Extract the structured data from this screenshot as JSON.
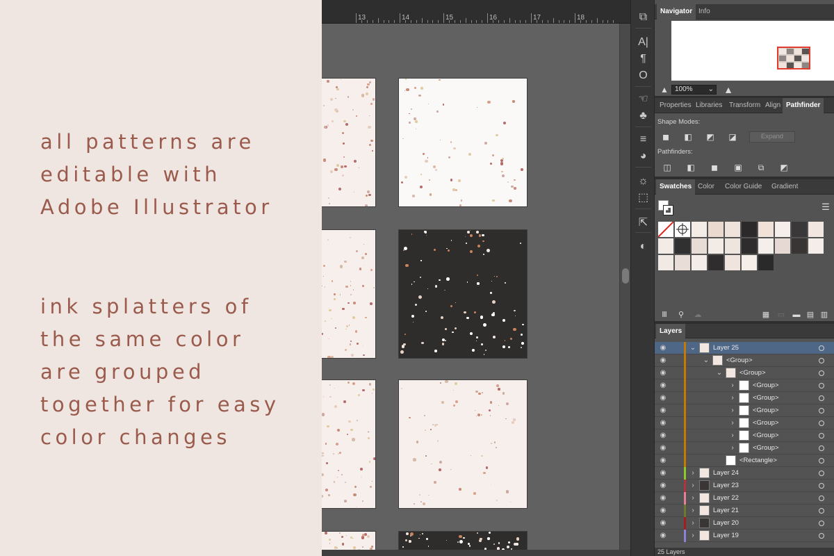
{
  "promo": {
    "block_a": [
      "all patterns are",
      "editable with",
      "Adobe Illustrator"
    ],
    "block_b": [
      "ink splatters of",
      "the same color",
      "are grouped",
      "together for easy",
      "color changes"
    ]
  },
  "ruler": {
    "labels": [
      "13",
      "14",
      "15",
      "16",
      "17",
      "18"
    ]
  },
  "tools": [
    "type-area-icon",
    "paragraph-icon",
    "opentype-icon",
    "puppet-icon",
    "club-symbol-icon",
    "align-lines-icon",
    "shape-builder-icon",
    "sun-icon",
    "export-icon",
    "external-link-icon",
    "color-wheel-icon"
  ],
  "navigator": {
    "tabs": [
      "Navigator",
      "Info"
    ],
    "zoom": "100%"
  },
  "properties": {
    "tabs": [
      "Properties",
      "Libraries",
      "Transform",
      "Align",
      "Pathfinder"
    ],
    "shape_modes_label": "Shape Modes:",
    "expand_label": "Expand",
    "pathfinders_label": "Pathfinders:"
  },
  "swatches": {
    "tabs": [
      "Swatches",
      "Color",
      "Color Guide",
      "Gradient"
    ],
    "colors": [
      "#f4ece6",
      "#e9d9cf",
      "#efe3dc",
      "#2b2929",
      "#f0e2d9",
      "#f6eeea",
      "#3a3838",
      "#f1e6e0",
      "#f2ebe6",
      "#303030",
      "#e8dcd6",
      "#f3ebe5",
      "#efe5df",
      "#2e2c2c",
      "#f5efeb",
      "#e6d8d2",
      "#3a3535",
      "#f4ede9",
      "#f1e9e4",
      "#e9ddd7",
      "#f3ece8",
      "#2f2d2d",
      "#efe4de",
      "#f5eee9",
      "#2b2a2a"
    ]
  },
  "layers": {
    "tab": "Layers",
    "footer": "25 Layers",
    "rows": [
      {
        "name": "Layer 25",
        "indent": 0,
        "chevron": "v",
        "selected": true,
        "color": "#c47a00",
        "dark": false
      },
      {
        "name": "<Group>",
        "indent": 1,
        "chevron": "v",
        "selected": false,
        "color": "#c47a00",
        "dark": false
      },
      {
        "name": "<Group>",
        "indent": 2,
        "chevron": "v",
        "selected": false,
        "color": "#c47a00",
        "dark": false
      },
      {
        "name": "<Group>",
        "indent": 3,
        "chevron": ">",
        "selected": false,
        "color": "#c47a00",
        "dark": false
      },
      {
        "name": "<Group>",
        "indent": 3,
        "chevron": ">",
        "selected": false,
        "color": "#c47a00",
        "dark": false
      },
      {
        "name": "<Group>",
        "indent": 3,
        "chevron": ">",
        "selected": false,
        "color": "#c47a00",
        "dark": false
      },
      {
        "name": "<Group>",
        "indent": 3,
        "chevron": ">",
        "selected": false,
        "color": "#c47a00",
        "dark": false
      },
      {
        "name": "<Group>",
        "indent": 3,
        "chevron": ">",
        "selected": false,
        "color": "#c47a00",
        "dark": false
      },
      {
        "name": "<Group>",
        "indent": 3,
        "chevron": ">",
        "selected": false,
        "color": "#c47a00",
        "dark": false
      },
      {
        "name": "<Rectangle>",
        "indent": 2,
        "chevron": "",
        "selected": false,
        "color": "#c47a00",
        "dark": false
      },
      {
        "name": "Layer 24",
        "indent": 0,
        "chevron": ">",
        "selected": false,
        "color": "#8ccc2b",
        "dark": false
      },
      {
        "name": "Layer 23",
        "indent": 0,
        "chevron": ">",
        "selected": false,
        "color": "#b0343a",
        "dark": true
      },
      {
        "name": "Layer 22",
        "indent": 0,
        "chevron": ">",
        "selected": false,
        "color": "#e77e9a",
        "dark": false
      },
      {
        "name": "Layer 21",
        "indent": 0,
        "chevron": ">",
        "selected": false,
        "color": "#6b7a2f",
        "dark": false
      },
      {
        "name": "Layer 20",
        "indent": 0,
        "chevron": ">",
        "selected": false,
        "color": "#a31d1d",
        "dark": true
      },
      {
        "name": "Layer 19",
        "indent": 0,
        "chevron": ">",
        "selected": false,
        "color": "#8b84d6",
        "dark": false
      }
    ]
  },
  "canvas": {
    "tiles": [
      "light",
      "light",
      "light",
      "dark",
      "light",
      "light",
      "light",
      "dark"
    ]
  }
}
